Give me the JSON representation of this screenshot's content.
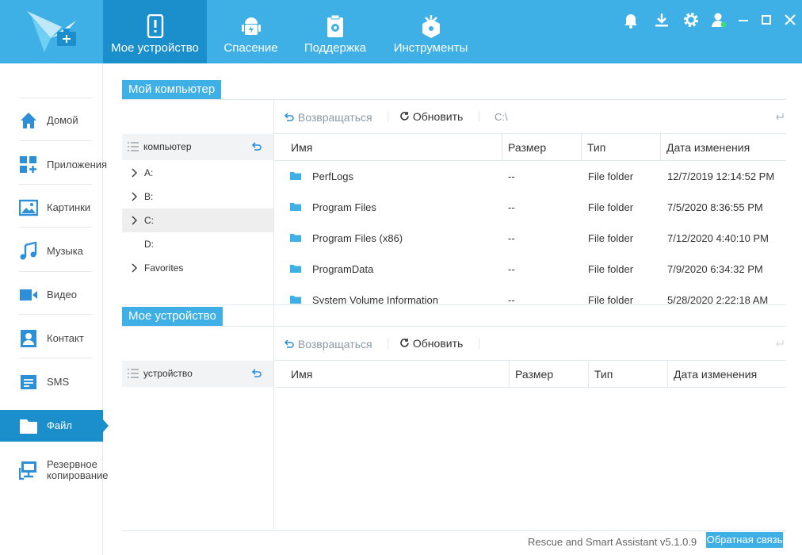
{
  "nav": {
    "tabs": [
      {
        "label": "Мое устройство",
        "icon": "phone-icon",
        "active": true
      },
      {
        "label": "Спасение",
        "icon": "android-icon",
        "active": false
      },
      {
        "label": "Поддержка",
        "icon": "clipboard-gear-icon",
        "active": false
      },
      {
        "label": "Инструменты",
        "icon": "toolbox-icon",
        "active": false
      }
    ],
    "window_controls": [
      "bell-icon",
      "download-icon",
      "gear-icon",
      "user-icon",
      "minimize-icon",
      "maximize-icon",
      "close-icon"
    ]
  },
  "sidebar": {
    "items": [
      {
        "label": "Домой",
        "icon": "home-icon"
      },
      {
        "label": "Приложения",
        "icon": "apps-icon"
      },
      {
        "label": "Картинки",
        "icon": "image-icon"
      },
      {
        "label": "Музыка",
        "icon": "music-icon"
      },
      {
        "label": "Видео",
        "icon": "video-icon"
      },
      {
        "label": "Контакт",
        "icon": "contact-icon"
      },
      {
        "label": "SMS",
        "icon": "sms-icon"
      },
      {
        "label": "Файл",
        "icon": "folder-icon",
        "active": true
      },
      {
        "label": "Резервное копирование",
        "icon": "backup-icon"
      }
    ]
  },
  "computer": {
    "title": "Мой компьютер",
    "tree_header": "компьютер",
    "tree_items": [
      {
        "label": "A:",
        "expandable": true
      },
      {
        "label": "B:",
        "expandable": true
      },
      {
        "label": "C:",
        "expandable": true,
        "selected": true
      },
      {
        "label": "D:",
        "expandable": false
      },
      {
        "label": "Favorites",
        "expandable": true
      }
    ],
    "toolbar": {
      "back": "Возвращаться",
      "refresh": "Обновить",
      "path": "C:\\"
    },
    "columns": [
      "Имя",
      "Размер",
      "Тип",
      "Дата изменения"
    ],
    "files": [
      {
        "name": "PerfLogs",
        "size": "--",
        "type": "File folder",
        "modified": "12/7/2019 12:14:52 PM"
      },
      {
        "name": "Program Files",
        "size": "--",
        "type": "File folder",
        "modified": "7/5/2020 8:36:55 PM"
      },
      {
        "name": "Program Files (x86)",
        "size": "--",
        "type": "File folder",
        "modified": "7/12/2020 4:40:10 PM"
      },
      {
        "name": "ProgramData",
        "size": "--",
        "type": "File folder",
        "modified": "7/9/2020 6:34:32 PM"
      },
      {
        "name": "System Volume Information",
        "size": "--",
        "type": "File folder",
        "modified": "5/28/2020 2:22:18 AM"
      }
    ]
  },
  "device": {
    "title": "Мое устройство",
    "tree_header": "устройство",
    "toolbar": {
      "back": "Возвращаться",
      "refresh": "Обновить"
    },
    "columns": [
      "Имя",
      "Размер",
      "Тип",
      "Дата изменения"
    ]
  },
  "footer": {
    "version": "Rescue and Smart Assistant v5.1.0.9",
    "feedback": "Обратная связь"
  },
  "colors": {
    "accent": "#3fb0e5",
    "active": "#1b8fcc"
  }
}
